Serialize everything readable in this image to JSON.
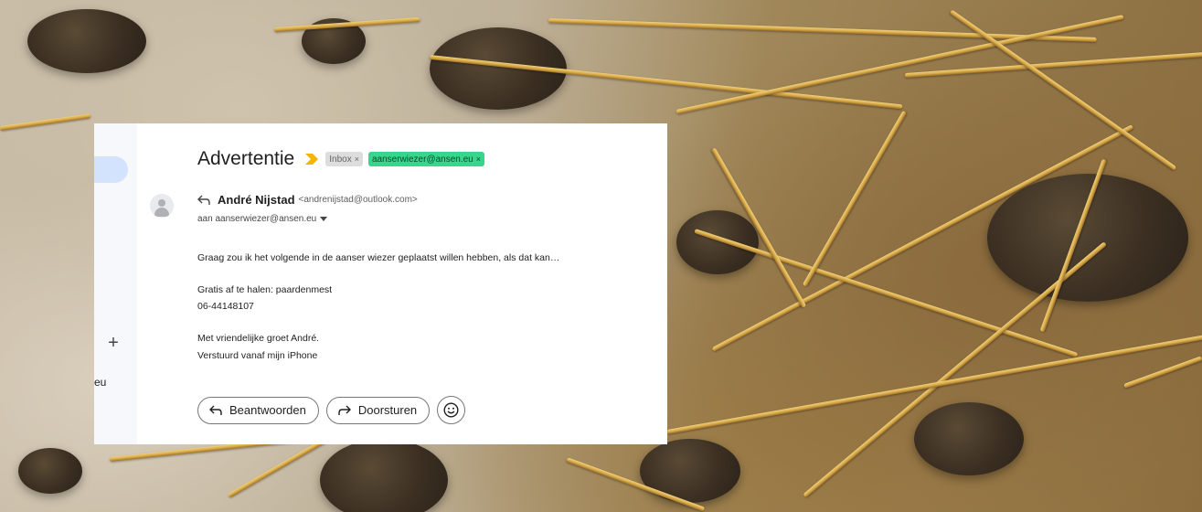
{
  "email": {
    "subject": "Advertentie",
    "labels": {
      "inbox": "Inbox",
      "inbox_close": "×",
      "address": "aanserwiezer@ansen.eu",
      "address_close": "×"
    },
    "sender_name": "André Nijstad",
    "sender_email": "<andrenijstad@outlook.com>",
    "to_line": "aan aanserwiezer@ansen.eu",
    "body": {
      "line1": "Graag zou ik het volgende in de aanser wiezer geplaatst willen hebben, als dat kan…",
      "line2": "Gratis af te halen: paardenmest",
      "line3": "06-44148107",
      "line4": "Met vriendelijke groet André.",
      "line5": "Verstuurd vanaf mijn iPhone"
    },
    "actions": {
      "reply": "Beantwoorden",
      "forward": "Doorsturen"
    }
  },
  "sidebar": {
    "plus": "+",
    "label_fragment": "eu"
  },
  "colors": {
    "label_chip": "#37d68d",
    "importance": "#f4b400",
    "compose_highlight": "#d3e3fd"
  },
  "icons": {
    "importance": "importance-marker-icon",
    "reply": "reply-arrow-icon",
    "forward": "forward-arrow-icon",
    "emoji": "emoji-reaction-icon",
    "avatar": "default-avatar-icon",
    "dropdown": "chevron-down-icon"
  }
}
